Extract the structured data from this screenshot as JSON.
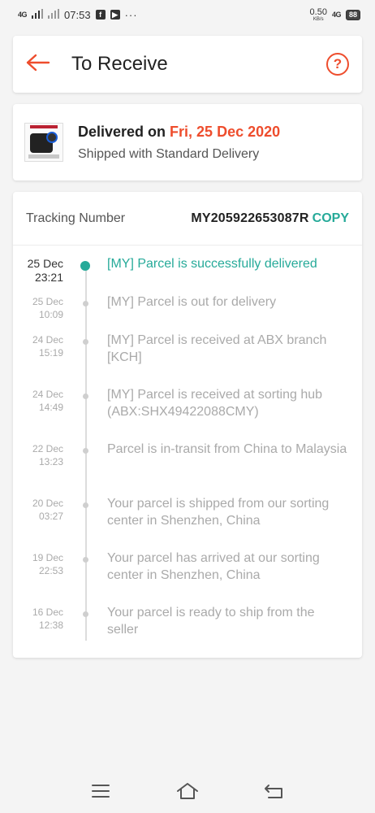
{
  "status_bar": {
    "network_left": "4G",
    "time": "07:53",
    "app_icon_1": "f",
    "app_icon_2": "▶",
    "more": "···",
    "speed_value": "0.50",
    "speed_unit": "KB/s",
    "network_right": "4G",
    "battery": "88"
  },
  "header": {
    "title": "To Receive",
    "back_icon": "arrow-left-icon",
    "help_icon": "question-circle-icon",
    "help_glyph": "?"
  },
  "delivery": {
    "prefix": "Delivered on ",
    "date": "Fri, 25 Dec 2020",
    "shipped_with": "Shipped with Standard Delivery"
  },
  "tracking": {
    "label": "Tracking Number",
    "number": "MY205922653087R",
    "copy_label": "COPY",
    "events": [
      {
        "date": "25 Dec",
        "time": "23:21",
        "text": "[MY] Parcel is successfully delivered"
      },
      {
        "date": "25 Dec",
        "time": "10:09",
        "text": "[MY] Parcel is out for delivery"
      },
      {
        "date": "24 Dec",
        "time": "15:19",
        "text": "[MY] Parcel is received at ABX branch [KCH]"
      },
      {
        "date": "24 Dec",
        "time": "14:49",
        "text": "[MY] Parcel is received at sorting hub (ABX:SHX49422088CMY)"
      },
      {
        "date": "22 Dec",
        "time": "13:23",
        "text": "Parcel is in-transit from China to Malaysia"
      },
      {
        "date": "20 Dec",
        "time": "03:27",
        "text": "Your parcel is shipped from our sorting center in Shenzhen, China"
      },
      {
        "date": "19 Dec",
        "time": "22:53",
        "text": "Your parcel has arrived at our sorting center in Shenzhen, China"
      },
      {
        "date": "16 Dec",
        "time": "12:38",
        "text": "Your parcel is ready to ship from the seller"
      }
    ]
  },
  "colors": {
    "accent": "#ee4d2d",
    "teal": "#26aa99"
  }
}
